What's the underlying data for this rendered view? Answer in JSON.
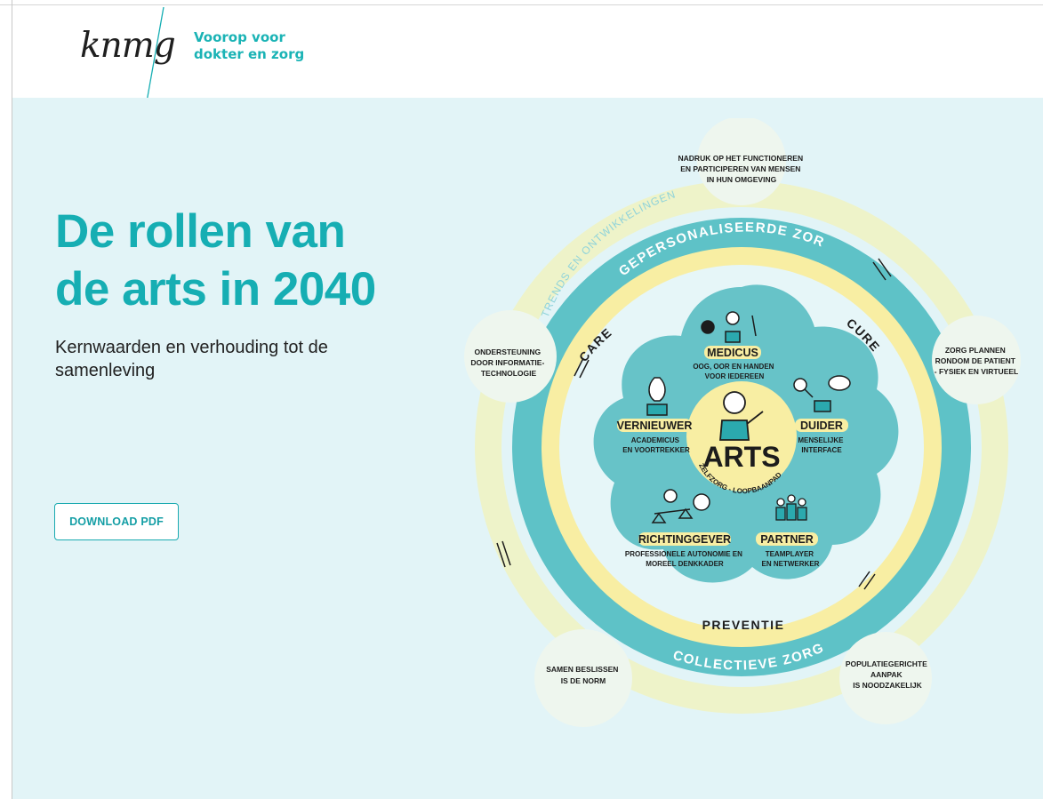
{
  "header": {
    "logo_text": "knmg",
    "tagline_line1": "Voorop voor",
    "tagline_line2": "dokter en zorg"
  },
  "hero": {
    "title_line1": "De rollen van",
    "title_line2": "de arts in 2040",
    "subtitle": "Kernwaarden en verhouding tot de samenleving",
    "download_label": "DOWNLOAD PDF"
  },
  "diagram": {
    "outer_ring_label": "TRENDS EN ONTWIKKELINGEN",
    "top_ring_label": "GEPERSONALISEERDE ZORG",
    "bottom_ring_label": "COLLECTIEVE ZORG",
    "care_label": "CARE",
    "cure_label": "CURE",
    "preventie_label": "PREVENTIE",
    "center_label": "ARTS",
    "center_arc_label": "ZELFZORG - LOOPBAANPAD",
    "bubbles": {
      "top": [
        "NADRUK OP HET FUNCTIONEREN",
        "EN PARTICIPEREN VAN MENSEN",
        "IN HUN OMGEVING"
      ],
      "left": [
        "ONDERSTEUNING",
        "DOOR INFORMATIE-",
        "TECHNOLOGIE"
      ],
      "right": [
        "ZORG PLANNEN",
        "RONDOM DE PATIENT",
        "- FYSIEK EN VIRTUEEL"
      ],
      "bottom_left": [
        "SAMEN BESLISSEN",
        "IS DE NORM"
      ],
      "bottom_right": [
        "POPULATIEGERICHTE",
        "AANPAK",
        "IS NOODZAKELIJK"
      ]
    },
    "roles": {
      "medicus": {
        "name": "MEDICUS",
        "desc": [
          "OOG, OOR EN HANDEN",
          "VOOR IEDEREEN"
        ]
      },
      "vernieuwer": {
        "name": "VERNIEUWER",
        "desc": [
          "ACADEMICUS",
          "EN VOORTREKKER"
        ]
      },
      "duider": {
        "name": "DUIDER",
        "desc": [
          "MENSELIJKE",
          "INTERFACE"
        ]
      },
      "richtinggever": {
        "name": "RICHTINGGEVER",
        "desc": [
          "PROFESSIONELE AUTONOMIE EN",
          "MOREEL DENKKADER"
        ]
      },
      "partner": {
        "name": "PARTNER",
        "desc": [
          "TEAMPLAYER",
          "EN NETWERKER"
        ]
      }
    },
    "icons": {
      "medicus": "eye-ear-hand-icon",
      "vernieuwer": "lightbulb-icon",
      "duider": "magnifier-speech-icon",
      "richtinggever": "scales-icon",
      "partner": "team-people-icon",
      "arts": "doctor-figure-icon"
    }
  },
  "colors": {
    "brand_teal": "#16aeb3",
    "hero_bg": "#e2f4f7",
    "ring_teal": "#5ec2c7",
    "ring_yellow": "#f8eea3",
    "outer_yellow": "#eef3c9"
  }
}
